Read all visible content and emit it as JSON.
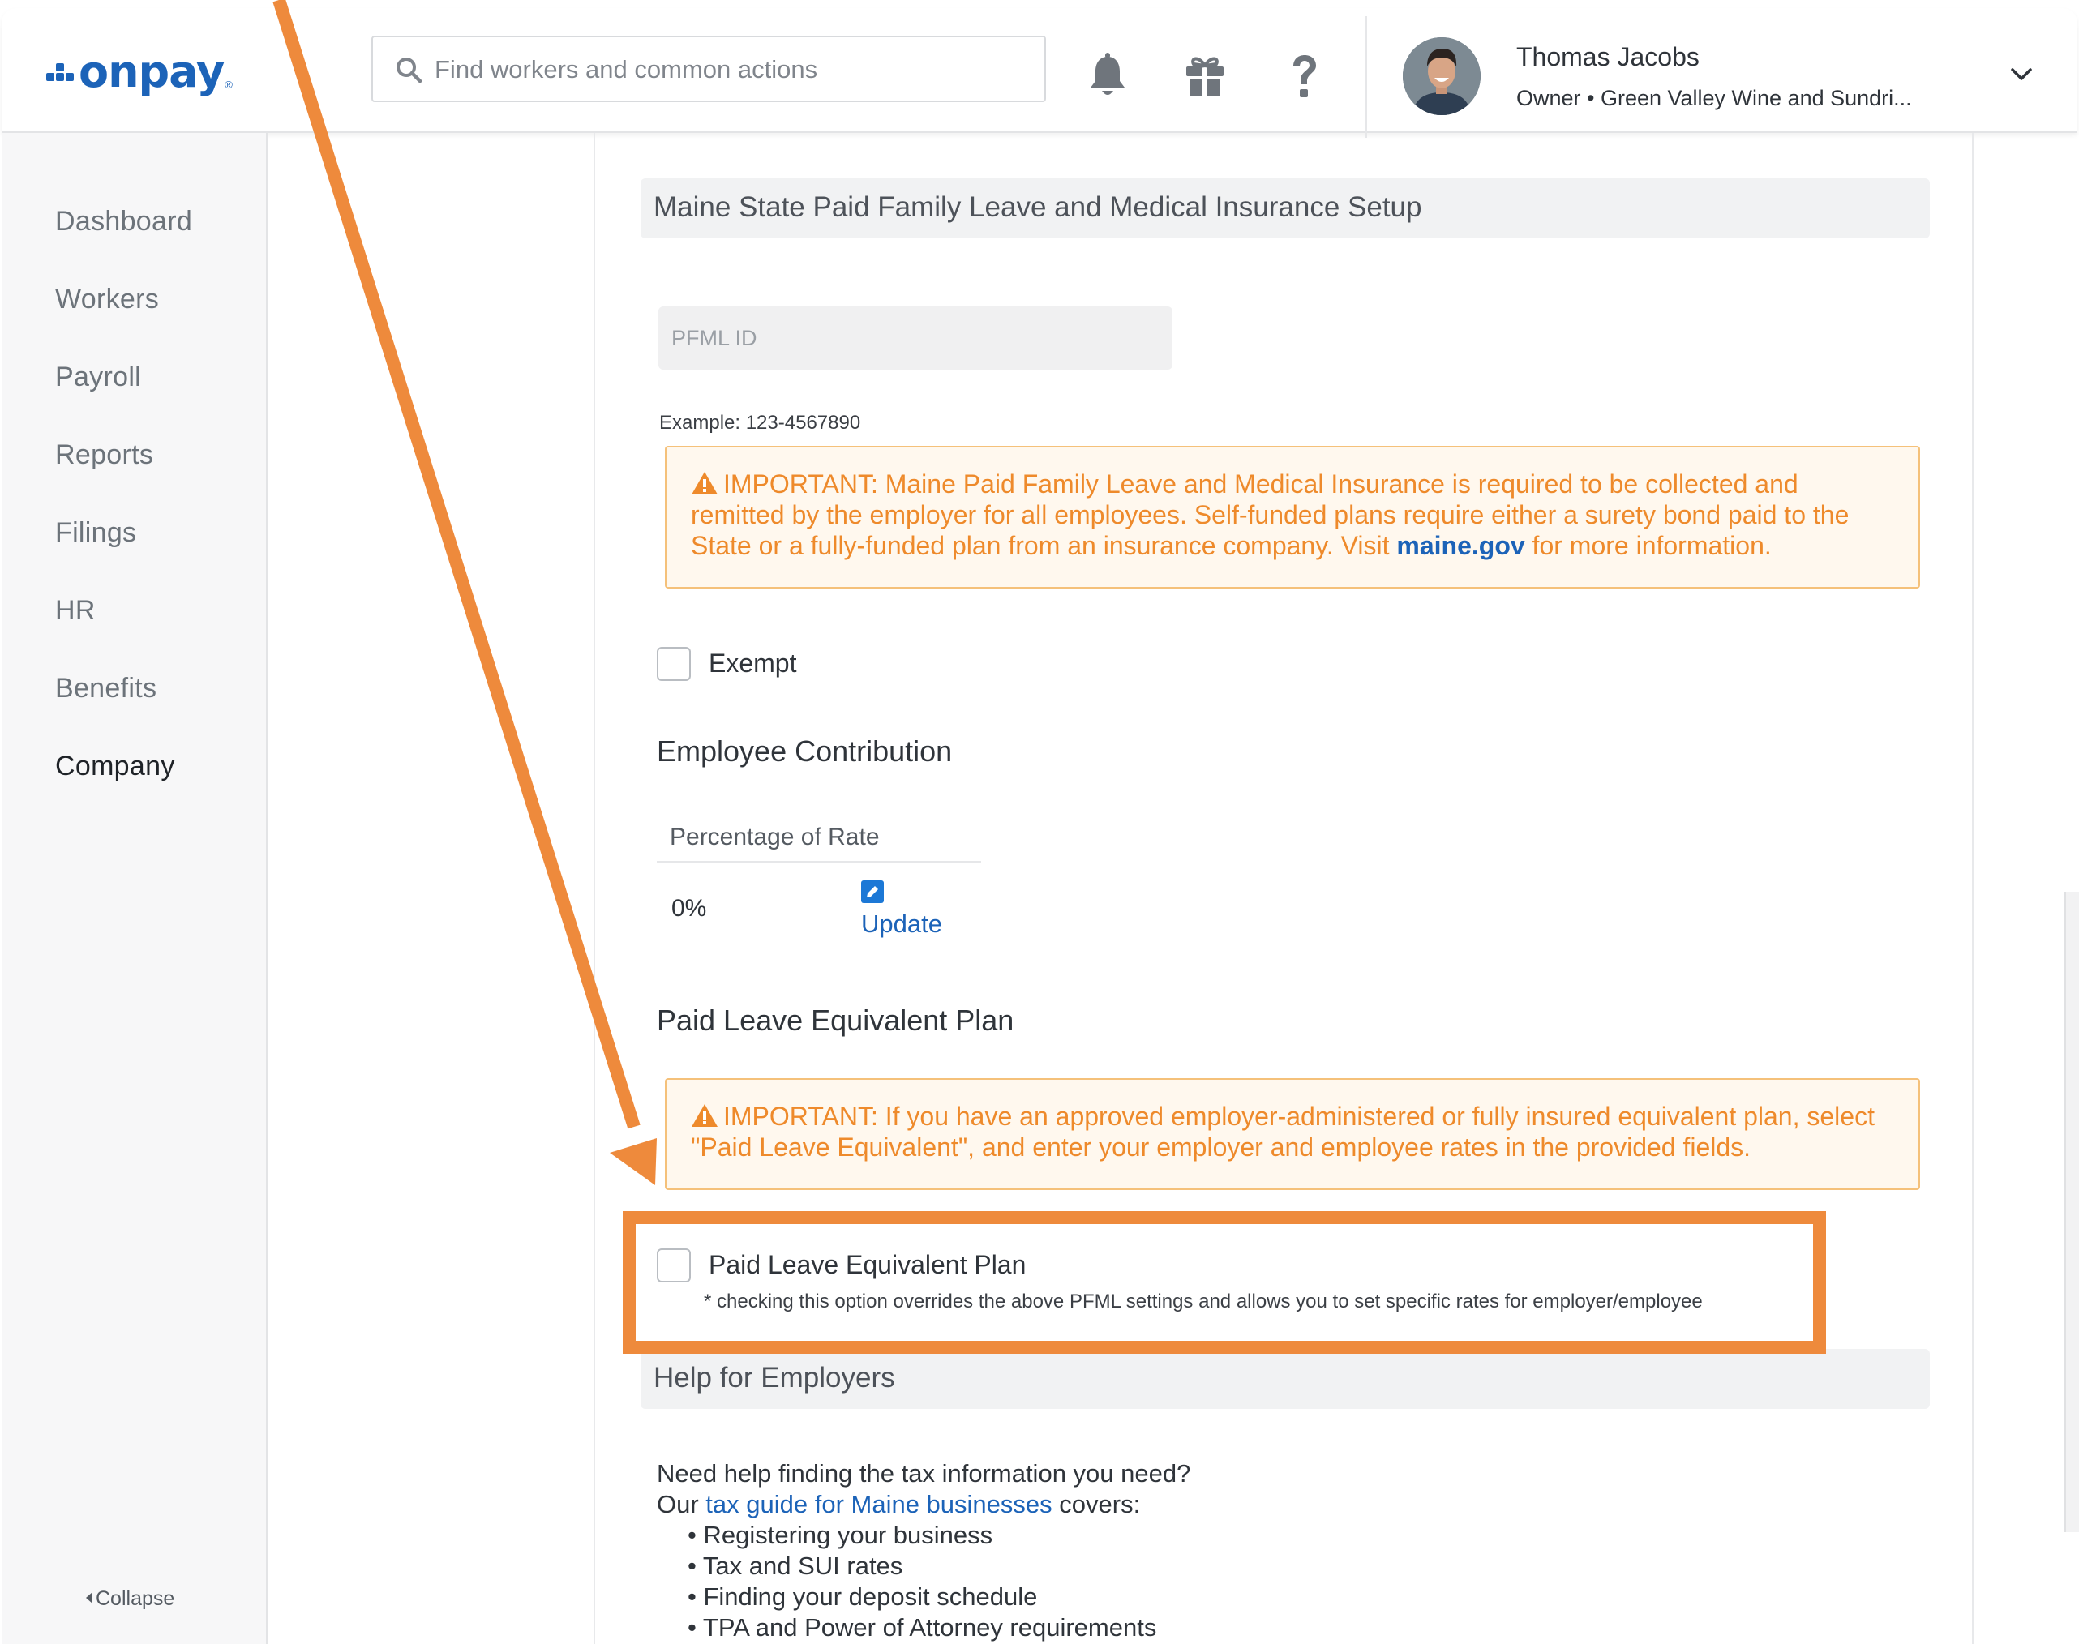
{
  "brand": {
    "name": "onpay",
    "color": "#1c63b8",
    "registered_mark": "®"
  },
  "header": {
    "search_placeholder": "Find workers and common actions",
    "icons": [
      "search-icon",
      "bell-icon",
      "gift-icon",
      "help-icon",
      "chevron-down-icon"
    ],
    "user": {
      "name": "Thomas Jacobs",
      "role": "Owner • Green Valley Wine and Sundri..."
    }
  },
  "sidebar": {
    "items": [
      {
        "label": "Dashboard",
        "active": false
      },
      {
        "label": "Workers",
        "active": false
      },
      {
        "label": "Payroll",
        "active": false
      },
      {
        "label": "Reports",
        "active": false
      },
      {
        "label": "Filings",
        "active": false
      },
      {
        "label": "HR",
        "active": false
      },
      {
        "label": "Benefits",
        "active": false
      },
      {
        "label": "Company",
        "active": true
      }
    ],
    "collapse_label": "Collapse"
  },
  "main": {
    "section_title": "Maine State Paid Family Leave and Medical Insurance Setup",
    "pfml_placeholder": "PFML ID",
    "example": "Example: 123-4567890",
    "alert1": {
      "text_before": "IMPORTANT: Maine Paid Family Leave and Medical Insurance is required to be collected and remitted by the employer for all employees. Self-funded plans require either a surety bond paid to the State or a fully-funded plan from an insurance company. Visit ",
      "link": "maine.gov",
      "text_after": " for more information."
    },
    "exempt_label": "Exempt",
    "employee_contribution": {
      "title": "Employee Contribution",
      "column": "Percentage of Rate",
      "value": "0%",
      "update_label": "Update"
    },
    "ple": {
      "title": "Paid Leave Equivalent Plan",
      "alert": "IMPORTANT: If you have an approved employer-administered or fully insured equivalent plan, select \"Paid Leave Equivalent\", and enter your employer and employee rates in the provided fields.",
      "checkbox_label": "Paid Leave Equivalent Plan",
      "note": "* checking this option overrides the above PFML settings and allows you to set specific rates for employer/employee"
    },
    "help": {
      "title": "Help for Employers",
      "line1": "Need help finding the tax information you need?",
      "line2_before": "Our ",
      "line2_link": "tax guide for Maine businesses",
      "line2_after": " covers:",
      "bullets": [
        "• Registering your business",
        "• Tax and SUI rates",
        "• Finding your deposit schedule",
        "• TPA and Power of Attorney requirements"
      ]
    }
  },
  "colors": {
    "warning": "#ee8a2b",
    "annotation": "#ee8a3c",
    "link": "#1c63b8"
  }
}
